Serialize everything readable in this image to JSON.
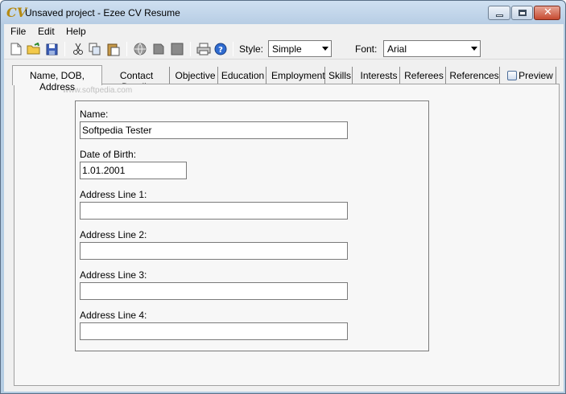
{
  "window": {
    "title": "Unsaved project - Ezee CV Resume",
    "app_icon_text": "CV"
  },
  "menu": [
    "File",
    "Edit",
    "Help"
  ],
  "toolbar": {
    "icons": [
      "new-file-icon",
      "open-folder-icon",
      "save-disk-icon",
      "cut-scissors-icon",
      "copy-icon",
      "paste-icon",
      "web-globe-icon",
      "pdf-icon",
      "print-layout-icon",
      "printer-icon",
      "help-icon"
    ],
    "style_label": "Style:",
    "style_value": "Simple",
    "font_label": "Font:",
    "font_value": "Arial"
  },
  "tabs": [
    {
      "label": "Name, DOB, Address",
      "active": true
    },
    {
      "label": "Contact Details"
    },
    {
      "label": "Objective"
    },
    {
      "label": "Education"
    },
    {
      "label": "Employment"
    },
    {
      "label": "Skills"
    },
    {
      "label": "Interests"
    },
    {
      "label": "Referees"
    },
    {
      "label": "References"
    },
    {
      "label": "Preview",
      "icon": "preview-icon"
    }
  ],
  "form": {
    "name_label": "Name:",
    "name_value": "Softpedia Tester",
    "dob_label": "Date of Birth:",
    "dob_value": "1.01.2001",
    "address1_label": "Address Line 1:",
    "address1_value": "",
    "address2_label": "Address Line 2:",
    "address2_value": "",
    "address3_label": "Address Line 3:",
    "address3_value": "",
    "address4_label": "Address Line 4:",
    "address4_value": ""
  },
  "watermark": "www.softpedia.com"
}
